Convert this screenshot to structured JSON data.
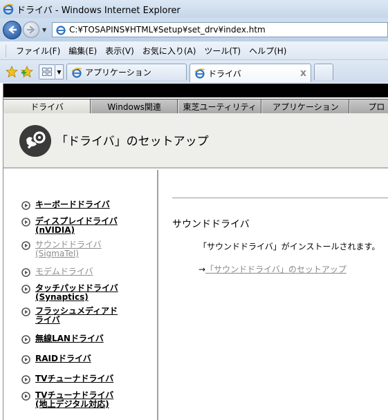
{
  "window": {
    "title": "ドライバ - Windows Internet Explorer"
  },
  "address_bar": {
    "url": "C:¥TOSAPINS¥HTML¥Setup¥set_drv¥index.htm"
  },
  "menu": [
    "ファイル(F)",
    "編集(E)",
    "表示(V)",
    "お気に入り(A)",
    "ツール(T)",
    "ヘルプ(H)"
  ],
  "tabs": [
    {
      "label": "アプリケーション",
      "active": false
    },
    {
      "label": "ドライバ",
      "active": true,
      "close": "x"
    }
  ],
  "site_nav": [
    "ドライバ",
    "Windows関連",
    "東芝ユーティリティ",
    "アプリケーション",
    "プロ"
  ],
  "header": {
    "title": "「ドライバ」のセットアップ"
  },
  "sidebar": [
    {
      "text": "キーボードドライバ",
      "dim": false
    },
    {
      "text": "ディスプレイドライバ(nVIDIA)",
      "dim": false
    },
    {
      "text": "サウンドドライバ(SigmaTel)",
      "dim": true
    },
    {
      "text": "モデムドライバ",
      "dim": true
    },
    {
      "text": "タッチパッドドライバ(Synaptics)",
      "dim": false
    },
    {
      "text": "フラッシュメディアドライバ",
      "dim": false
    },
    {
      "text": "無線LANドライバ",
      "dim": false
    },
    {
      "text": "RAIDドライバ",
      "dim": false
    },
    {
      "text": "TVチューナドライバ",
      "dim": false
    },
    {
      "text": "TVチューナドライバ(地上デジタル対応)",
      "dim": false
    }
  ],
  "main": {
    "title": "サウンドドライバ",
    "description": "「サウンドドライバ」がインストールされます。",
    "link_arrow": "→",
    "link_text": "「サウンドドライバ」のセットアップ"
  },
  "colors": {
    "blackbar": "#000000",
    "header_bg": "#eeeeea",
    "dim_text": "#8c8c8c"
  }
}
